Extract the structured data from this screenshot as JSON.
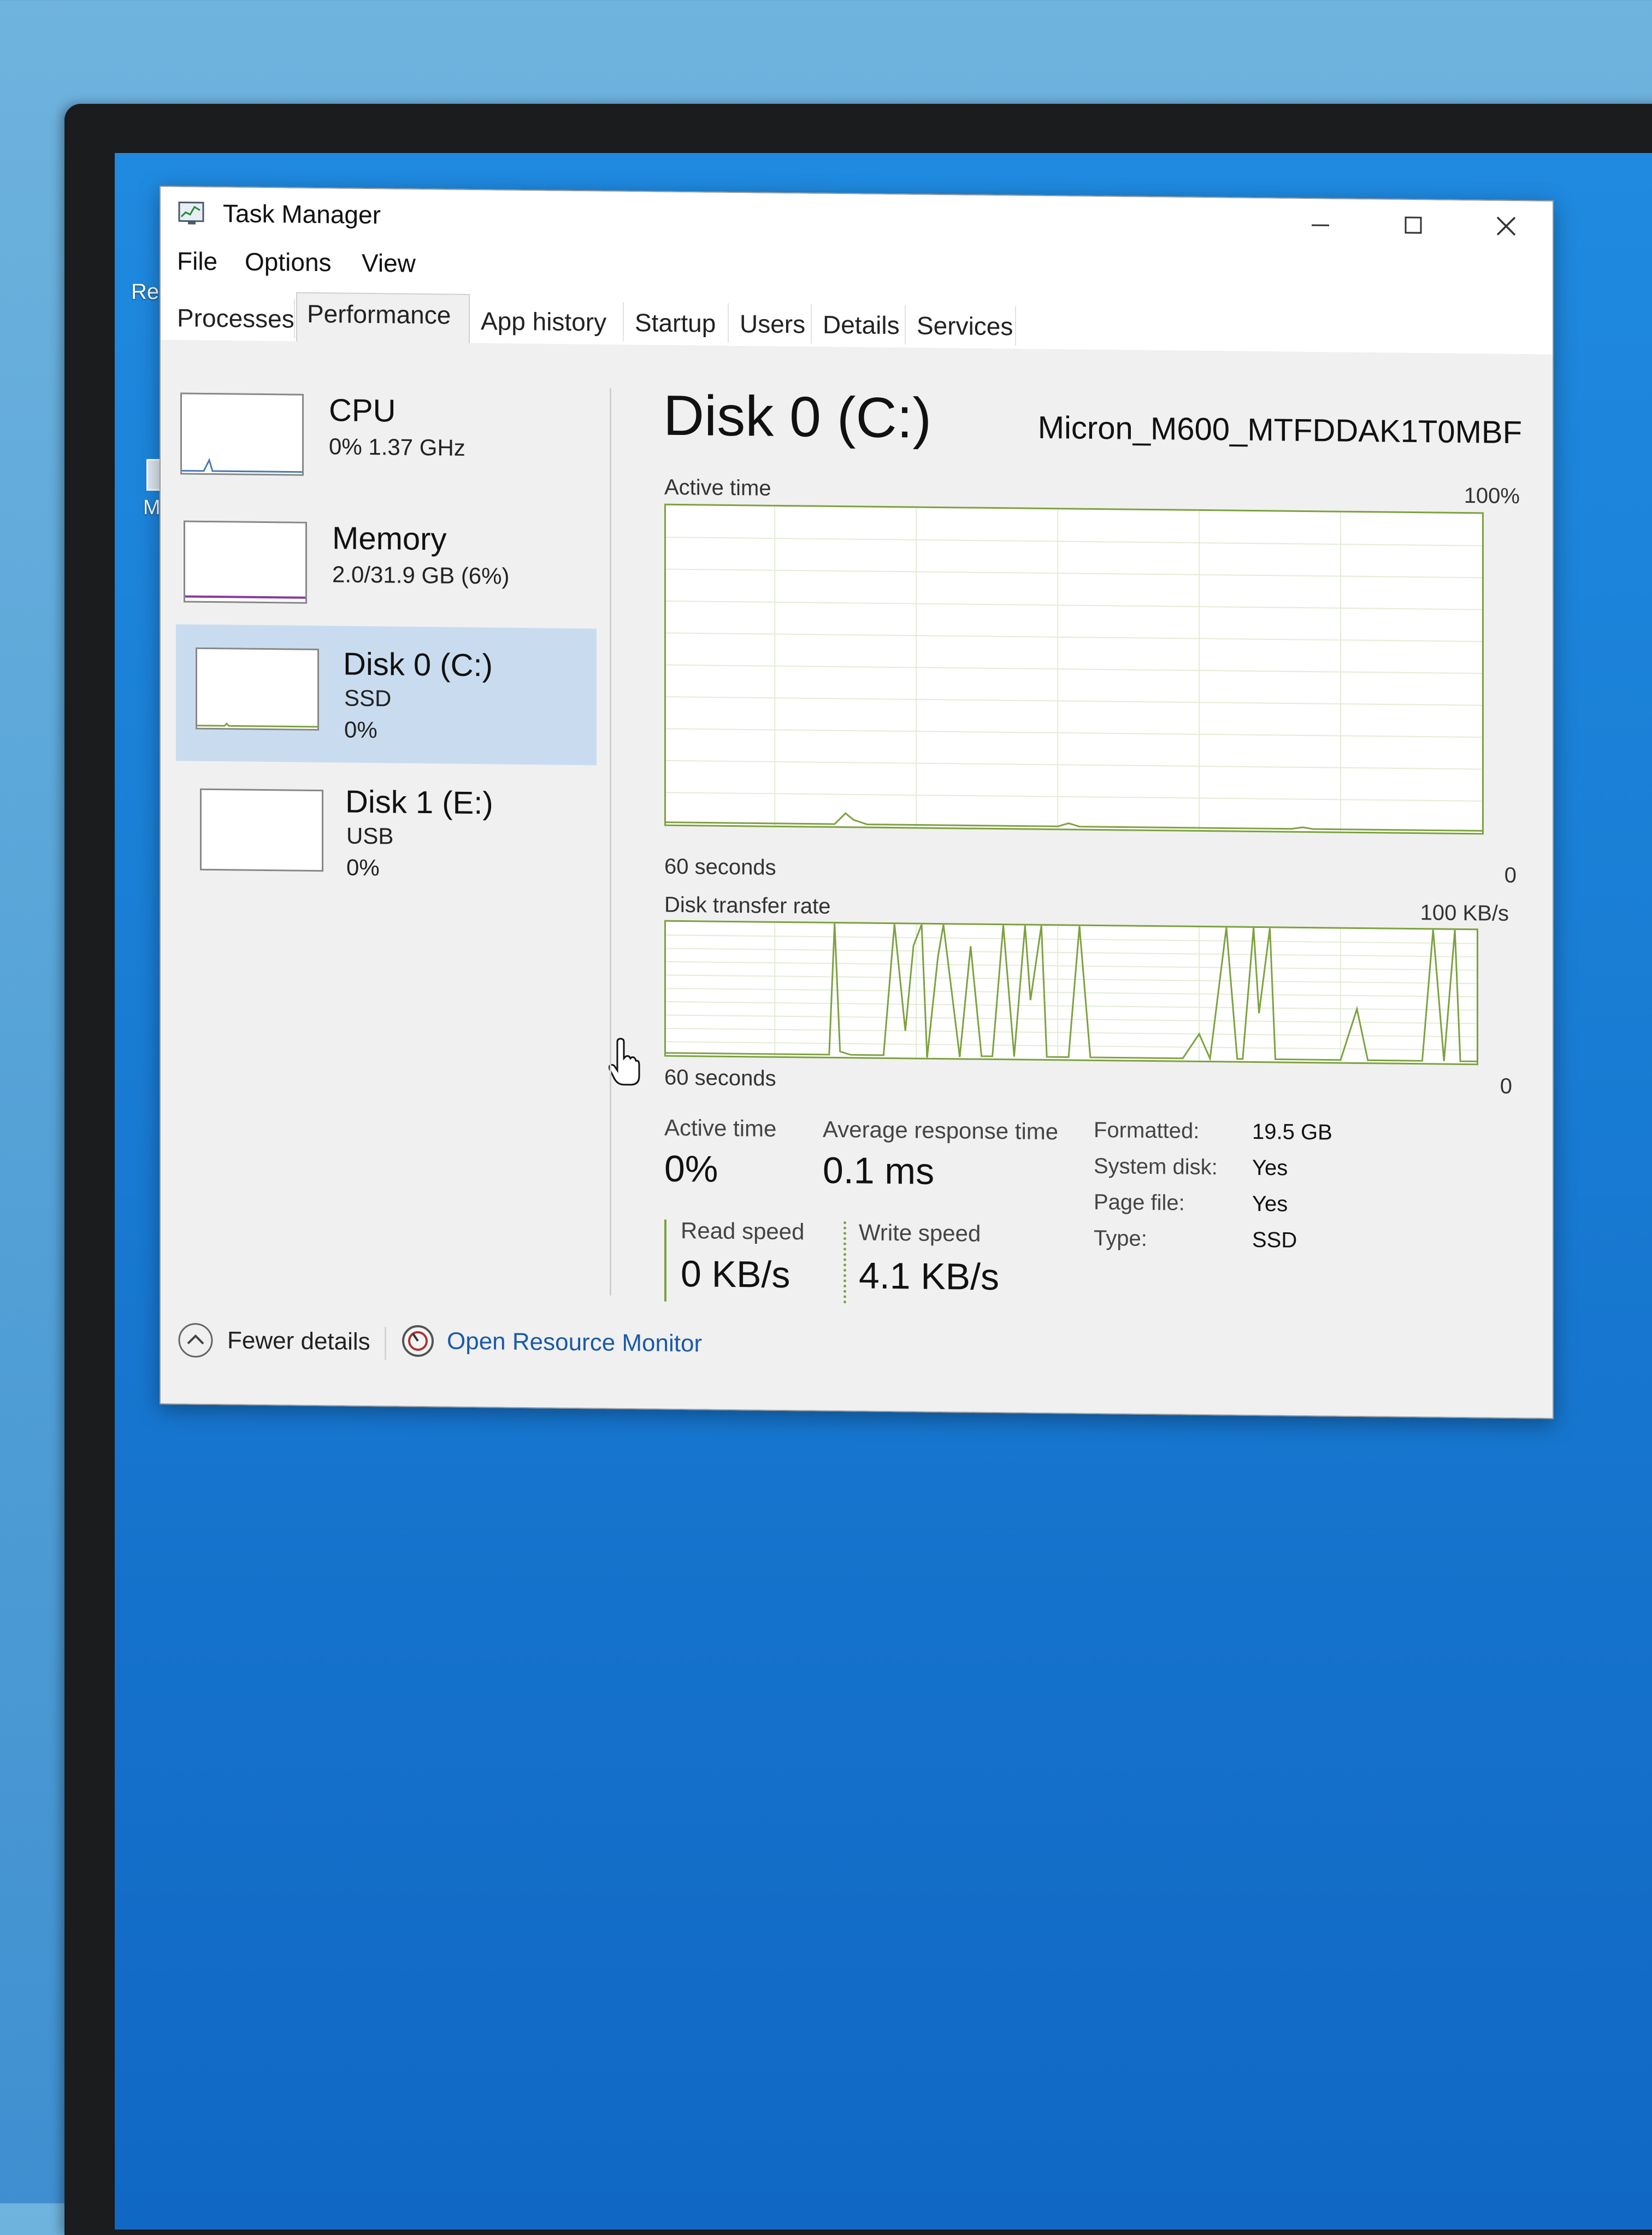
{
  "window": {
    "title": "Task Manager",
    "minimize": "–",
    "maximize": "☐",
    "close": "✕"
  },
  "menu": [
    "File",
    "Options",
    "View"
  ],
  "tabs": [
    "Processes",
    "Performance",
    "App history",
    "Startup",
    "Users",
    "Details",
    "Services"
  ],
  "active_tab": "Performance",
  "desktop": {
    "label_1": "Re",
    "label_2": "M"
  },
  "resources": [
    {
      "name": "CPU",
      "line1": "0%  1.37 GHz",
      "line2": ""
    },
    {
      "name": "Memory",
      "line1": "2.0/31.9 GB (6%)",
      "line2": ""
    },
    {
      "name": "Disk 0 (C:)",
      "line1": "SSD",
      "line2": "0%"
    },
    {
      "name": "Disk 1 (E:)",
      "line1": "USB",
      "line2": "0%"
    }
  ],
  "detail": {
    "title": "Disk 0 (C:)",
    "model": "Micron_M600_MTFDDAK1T0MBF",
    "active_time_label": "Active time",
    "active_time_max": "100%",
    "active_time_xlabel": "60 seconds",
    "active_time_zero": "0",
    "transfer_label": "Disk transfer rate",
    "transfer_max": "100 KB/s",
    "transfer_xlabel": "60 seconds",
    "transfer_zero": "0"
  },
  "stats": {
    "active_time_label": "Active time",
    "active_time_value": "0%",
    "avg_response_label": "Average response time",
    "avg_response_value": "0.1 ms",
    "read_label": "Read speed",
    "read_value": "0 KB/s",
    "write_label": "Write speed",
    "write_value": "4.1 KB/s"
  },
  "props": [
    {
      "label": "Formatted:",
      "value": "19.5 GB"
    },
    {
      "label": "System disk:",
      "value": "Yes"
    },
    {
      "label": "Page file:",
      "value": "Yes"
    },
    {
      "label": "Type:",
      "value": "SSD"
    }
  ],
  "footer": {
    "fewer_details": "Fewer details",
    "open_resource_monitor": "Open Resource Monitor"
  },
  "colors": {
    "graph_line": "#7da13f",
    "selected_bg": "#c9dcef",
    "link": "#1a5aa8"
  }
}
